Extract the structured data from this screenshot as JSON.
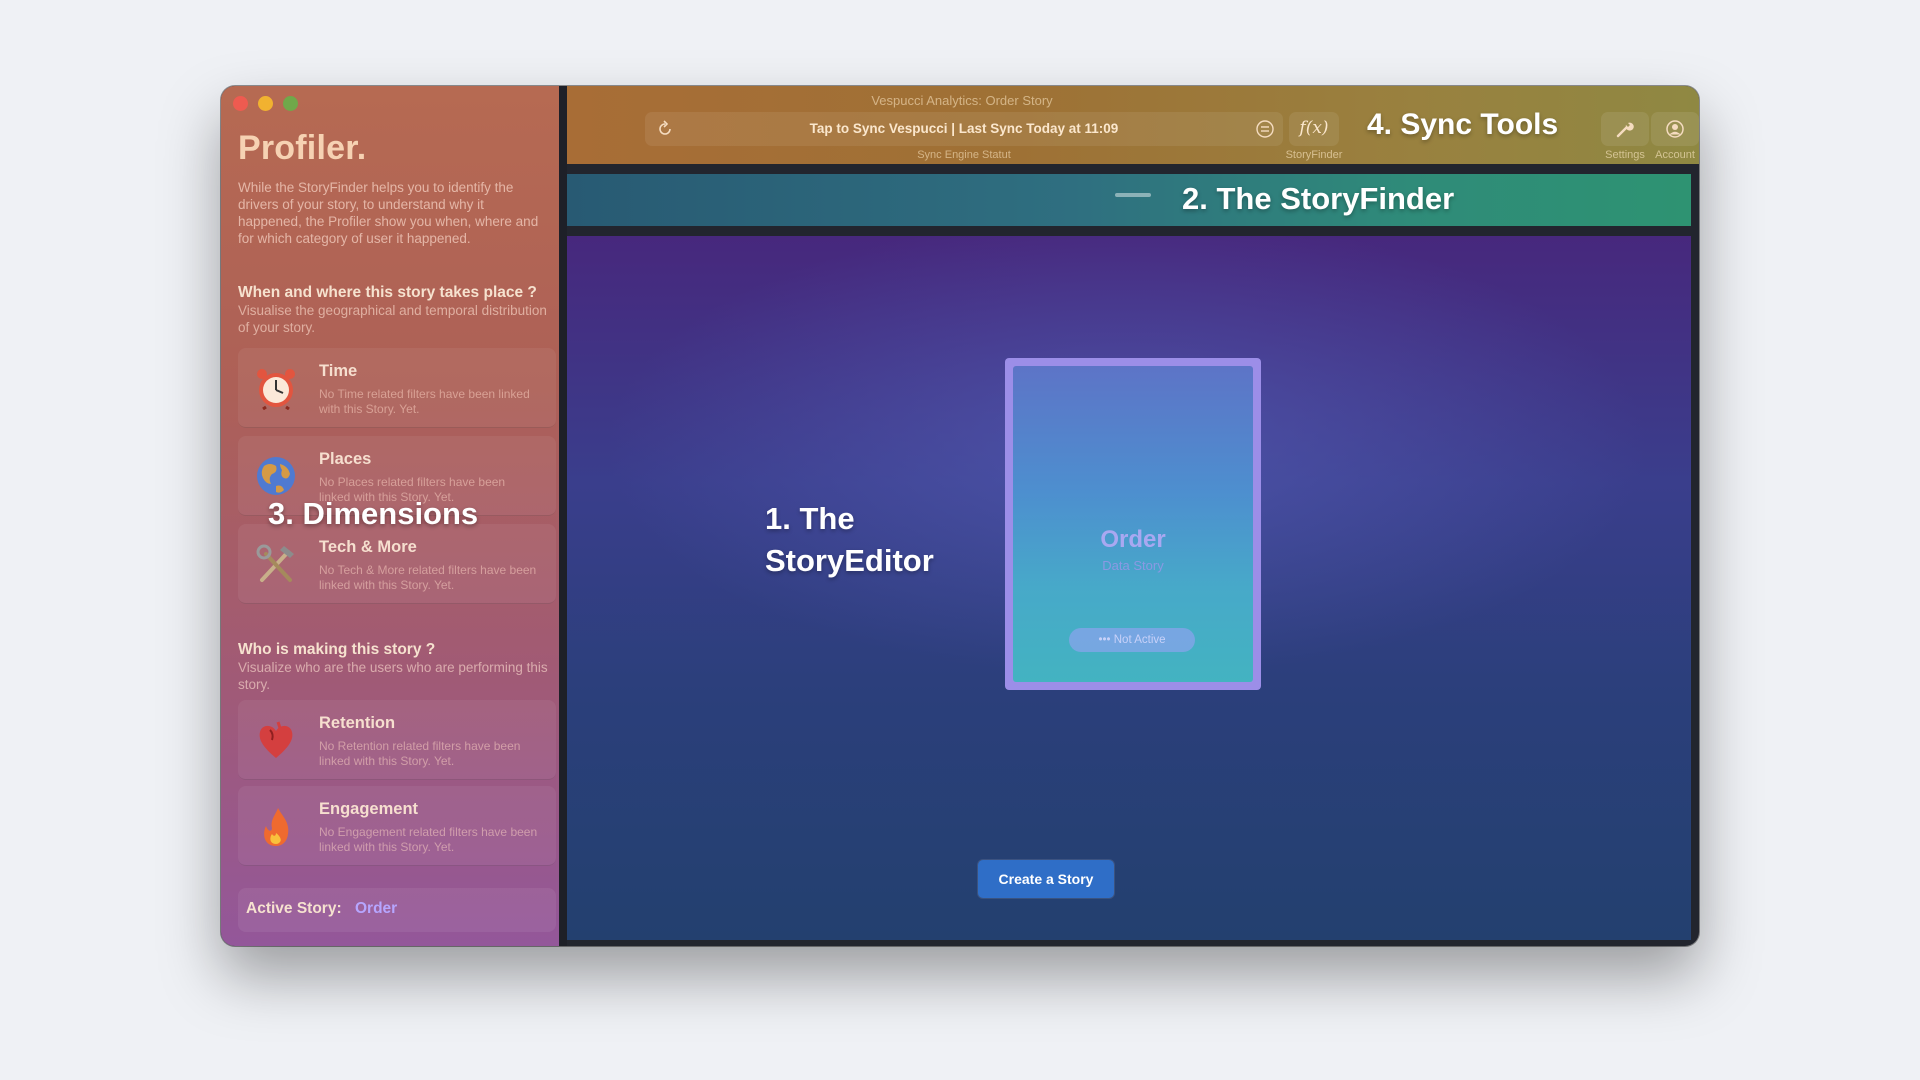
{
  "window": {
    "title": "Vespucci Analytics: Order Story"
  },
  "sidebar": {
    "title": "Profiler.",
    "description": "While the StoryFinder helps you to identify the drivers of your story, to understand why it happened, the Profiler show you when, where and for which category of user it happened.",
    "section1": {
      "title": "When and where this story takes place ?",
      "subtitle": "Visualise the geographical and temporal distribution of your story."
    },
    "dimensions": [
      {
        "title": "Time",
        "text": "No Time related filters have been linked with this Story. Yet.",
        "icon": "alarm-clock-icon"
      },
      {
        "title": "Places",
        "text": "No Places related filters have been linked with this Story. Yet.",
        "icon": "globe-icon"
      },
      {
        "title": "Tech & More",
        "text": "No Tech & More related filters have been linked with this Story. Yet.",
        "icon": "tools-icon"
      }
    ],
    "section2": {
      "title": "Who is making this story ?",
      "subtitle": "Visualize who are the users who are performing this story."
    },
    "users": [
      {
        "title": "Retention",
        "text": "No Retention related filters have been linked with this Story. Yet.",
        "icon": "heart-icon"
      },
      {
        "title": "Engagement",
        "text": "No Engagement related filters have been linked with this Story. Yet.",
        "icon": "fire-icon"
      }
    ],
    "active_story": {
      "label": "Active Story:",
      "value": "Order"
    }
  },
  "toolbar": {
    "sync_text": "Tap to Sync Vespucci | Last Sync Today at 11:09",
    "sync_caption": "Sync Engine Statut",
    "fx_label": "f(x)",
    "fx_caption": "StoryFinder",
    "settings_caption": "Settings",
    "account_caption": "Account"
  },
  "editor": {
    "story": {
      "title": "Order",
      "subtitle": "Data Story",
      "status": "••• Not Active"
    },
    "create_button": "Create a Story"
  },
  "overlays": {
    "story_editor_line1": "1. The",
    "story_editor_line2": "StoryEditor",
    "storyfinder": "2. The StoryFinder",
    "dimensions": "3. Dimensions",
    "sync_tools": "4. Sync Tools"
  },
  "colors": {
    "accent": "#2f6ec7",
    "active_story": "#b6a6ff",
    "sidebar_top": "#b66a52",
    "sidebar_bottom": "#93579a",
    "storyfinder": "#2f8b79"
  }
}
